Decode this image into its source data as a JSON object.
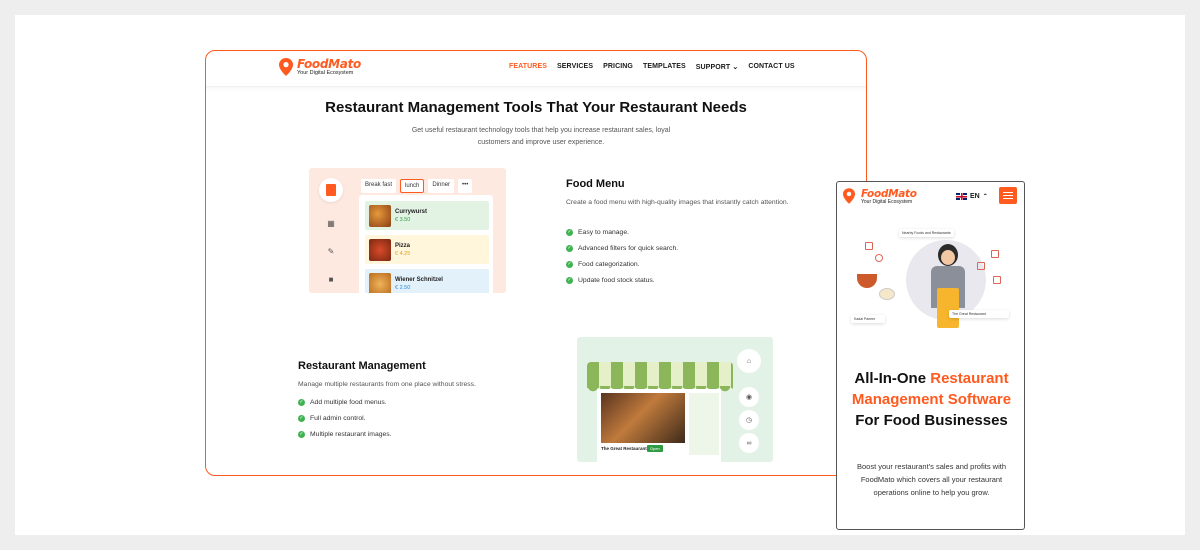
{
  "desktop": {
    "logo": {
      "name": "FoodMato",
      "tagline": "Your Digital Ecosystem"
    },
    "nav": {
      "items": [
        "FEATURES",
        "SERVICES",
        "PRICING",
        "TEMPLATES",
        "SUPPORT ⌄",
        "CONTACT US"
      ],
      "active_index": 0
    },
    "hero": {
      "title": "Restaurant Management Tools That Your Restaurant Needs",
      "subtitle": "Get useful restaurant technology tools that help you increase restaurant sales, loyal customers and improve user experience."
    },
    "food_menu_mock": {
      "tabs": [
        "Break fast",
        "lunch",
        "Dinner",
        "•••"
      ],
      "selected_tab": "lunch",
      "items": [
        {
          "name": "Currywurst",
          "price": "€ 3.50",
          "bg": "#e2f3e4",
          "price_color": "#2f9b43"
        },
        {
          "name": "Pizza",
          "price": "€ 4.25",
          "bg": "#fff6dc",
          "price_color": "#e0a21b"
        },
        {
          "name": "Wiener Schnitzel",
          "price": "€ 2.50",
          "bg": "#e3f1fb",
          "price_color": "#2a8bd6"
        }
      ]
    },
    "food_menu": {
      "title": "Food Menu",
      "description": "Create a food menu with high-quality images that instantly catch attention.",
      "features": [
        "Easy to manage.",
        "Advanced filters for quick search.",
        "Food categorization.",
        "Update food stock status."
      ]
    },
    "restaurant_mgmt": {
      "title": "Restaurant Management",
      "description": "Manage multiple restaurants from one place without stress.",
      "features": [
        "Add multiple food menus.",
        "Full admin control.",
        "Multiple restaurant images."
      ]
    },
    "restaurant_mock": {
      "card_label": "The Great Restaurant",
      "status": "Open"
    }
  },
  "mobile": {
    "logo": {
      "name": "FoodMato",
      "tagline": "Your Digital Ecosystem"
    },
    "language": "EN",
    "illustration": {
      "top_chip": "Nearby Foods and Restaurants",
      "card_left": "Kadai Paneer",
      "card_right": "The Great Restaurant"
    },
    "title_parts": {
      "pre": "All-In-One ",
      "highlight": "Restaurant Management Software",
      "post": " For Food Businesses"
    },
    "description": "Boost your restaurant's sales and profits with FoodMato which covers all your restaurant operations online to help you grow."
  },
  "colors": {
    "brand": "#ff5a1f",
    "check": "#3fb24f",
    "frame_border": "#ff5a1f"
  }
}
